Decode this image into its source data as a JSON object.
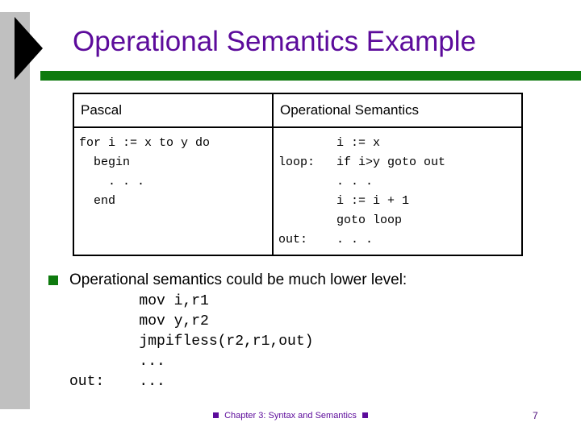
{
  "slide": {
    "title": "Operational Semantics Example",
    "accent_purple": "#5C0B9B",
    "accent_green": "#0E7A0E",
    "band_gray": "#C0C0C0",
    "background": "#FFFFFF"
  },
  "table": {
    "headers": {
      "left": "Pascal",
      "right": "Operational Semantics"
    },
    "cells": {
      "pascal_code": "for i := x to y do\n  begin\n    . . .\n  end",
      "opsem_code": "        i := x\nloop:   if i>y goto out\n        . . .\n        i := i + 1\n        goto loop\nout:    . . ."
    }
  },
  "bullet": {
    "marker": "green-square-bullet",
    "text": "Operational semantics could be much lower level:",
    "asm_code": "        mov i,r1\n        mov y,r2\n        jmpifless(r2,r1,out)\n        ...\nout:    ..."
  },
  "footer": {
    "text": "Chapter 3: Syntax and Semantics",
    "left_marker": "purple-square-bullet",
    "right_marker": "purple-square-bullet",
    "page_number": "7"
  }
}
